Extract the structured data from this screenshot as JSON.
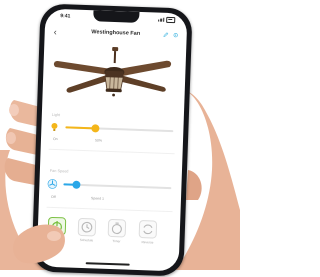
{
  "status_bar": {
    "time": "9:41"
  },
  "header": {
    "title": "Westinghouse Fan"
  },
  "light": {
    "label": "Light",
    "level": 0.28,
    "min_label": "On",
    "mid_label": "50%",
    "accent": "#f4b61a"
  },
  "fan_speed": {
    "label": "Fan Speed",
    "level": 0.12,
    "min_label": "Off",
    "mid_label": "Speed 1",
    "accent": "#2aa7e8"
  },
  "bottom_bar": {
    "items": [
      {
        "label": "Power",
        "icon": "power-icon",
        "active": true
      },
      {
        "label": "Schedule",
        "icon": "clock-icon",
        "active": false
      },
      {
        "label": "Timer",
        "icon": "timer-icon",
        "active": false
      },
      {
        "label": "Reverse",
        "icon": "reverse-icon",
        "active": false
      }
    ]
  },
  "colors": {
    "accent_green": "#7bc043",
    "phone_body": "#15161a"
  }
}
